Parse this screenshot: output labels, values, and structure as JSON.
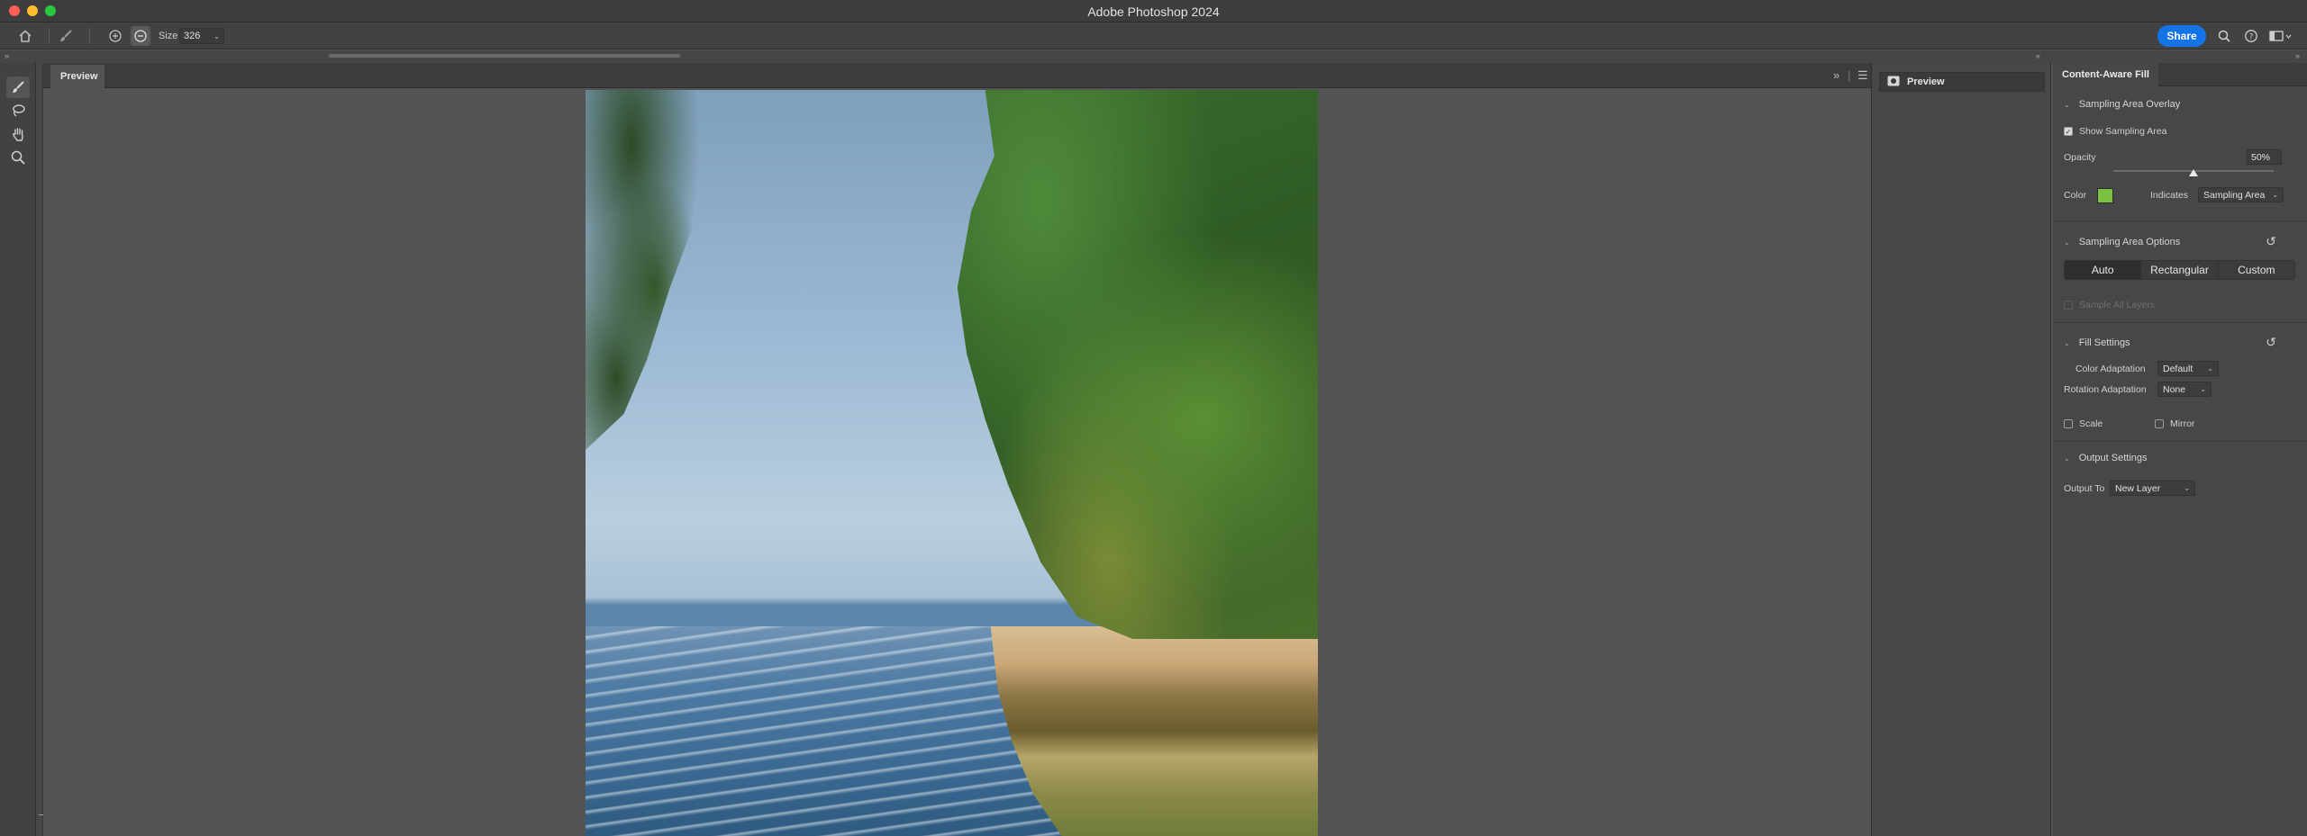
{
  "window": {
    "title": "Adobe Photoshop 2024"
  },
  "options_bar": {
    "size_label": "Size",
    "size_value": "326",
    "share_label": "Share"
  },
  "document": {
    "tab_label": "Preview"
  },
  "preview_panel": {
    "title": "Preview"
  },
  "caf": {
    "panel_title": "Content-Aware Fill",
    "overlay": {
      "heading": "Sampling Area Overlay",
      "show_label": "Show Sampling Area",
      "show_checked": true,
      "opacity_label": "Opacity",
      "opacity_value": "50%",
      "opacity_fraction": 0.5,
      "color_label": "Color",
      "color_hex": "#7cc142",
      "indicates_label": "Indicates",
      "indicates_value": "Sampling Area"
    },
    "sampling": {
      "heading": "Sampling Area Options",
      "modes": [
        "Auto",
        "Rectangular",
        "Custom"
      ],
      "selected_mode": "Auto",
      "sample_all_label": "Sample All Layers"
    },
    "fill": {
      "heading": "Fill Settings",
      "color_adaptation_label": "Color Adaptation",
      "color_adaptation_value": "Default",
      "rotation_adaptation_label": "Rotation Adaptation",
      "rotation_adaptation_value": "None",
      "scale_label": "Scale",
      "mirror_label": "Mirror"
    },
    "output": {
      "heading": "Output Settings",
      "output_to_label": "Output To",
      "output_to_value": "New Layer"
    }
  },
  "colors": {
    "accent": "#1473e6",
    "panel": "#474747",
    "background": "#535353"
  }
}
